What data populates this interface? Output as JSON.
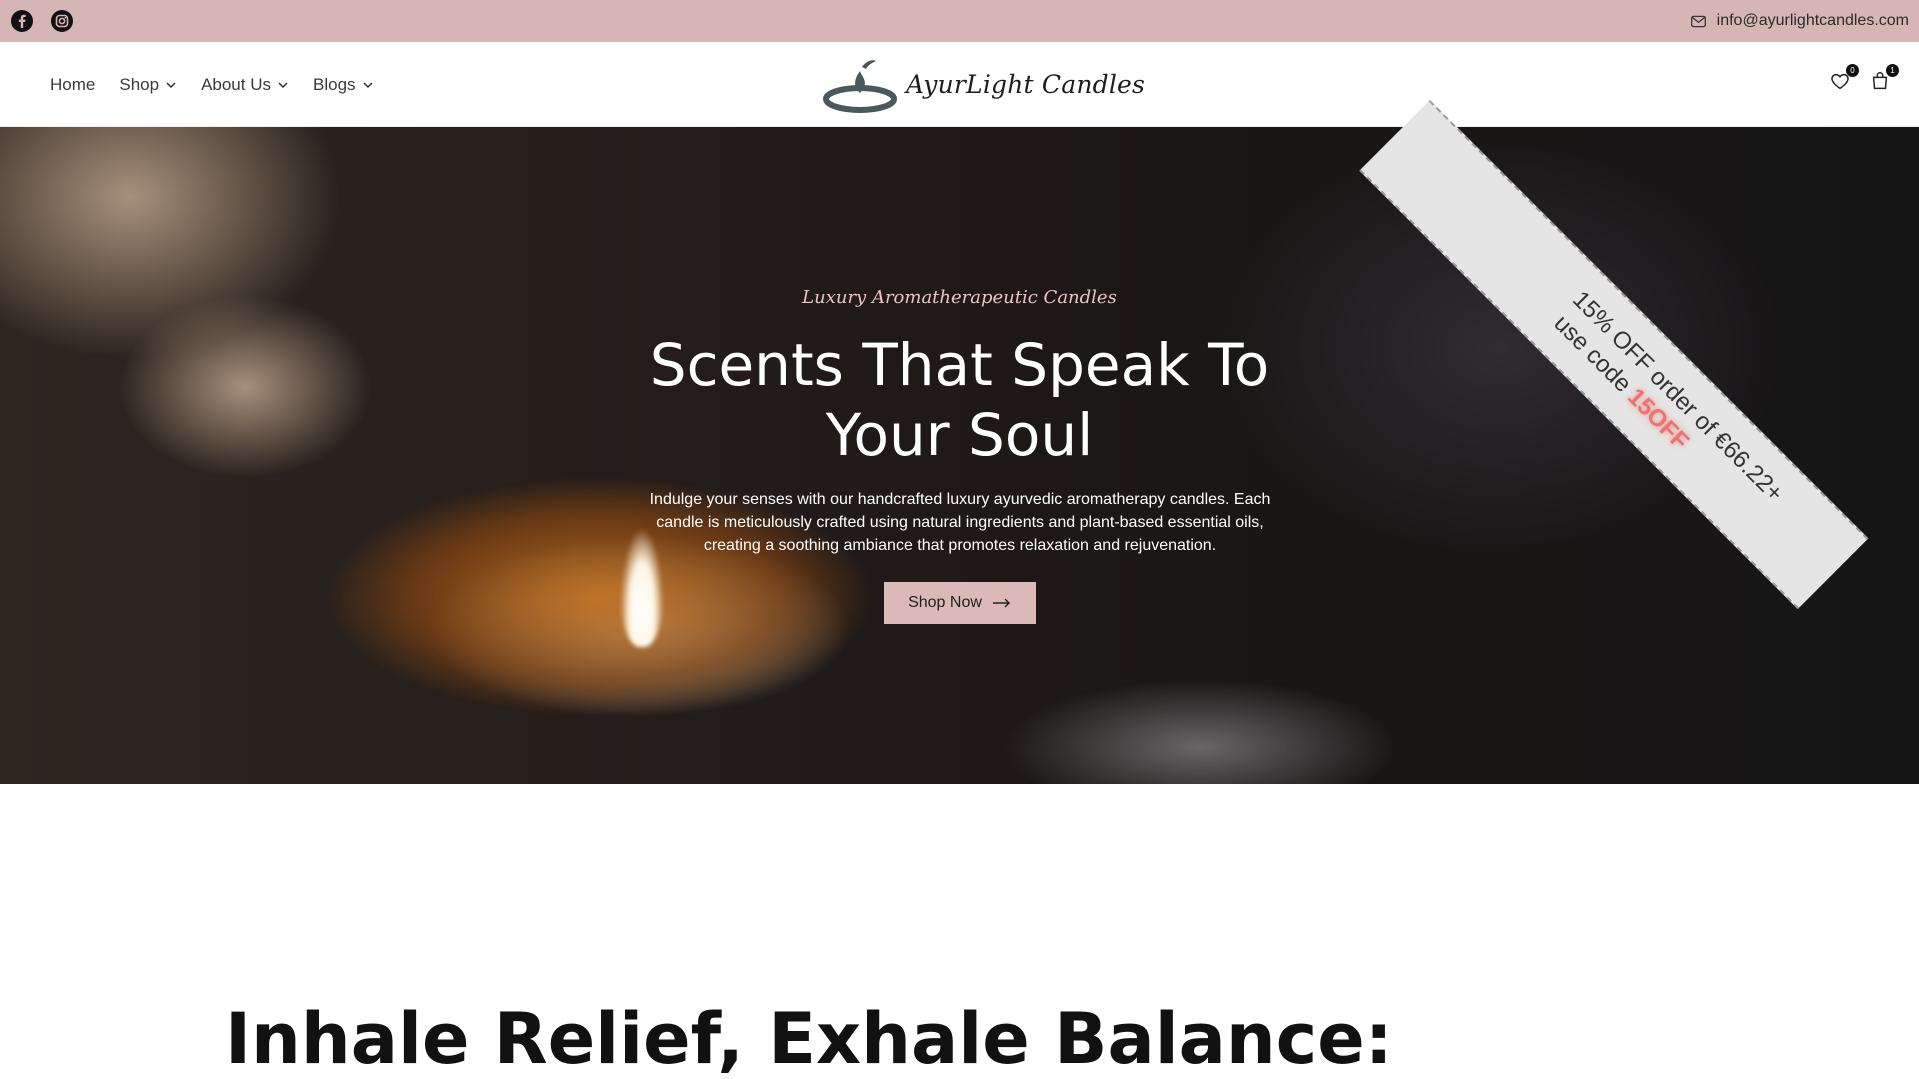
{
  "topbar": {
    "email": "info@ayurlightcandles.com",
    "social": [
      "facebook-icon",
      "instagram-icon"
    ]
  },
  "nav": {
    "items": [
      {
        "label": "Home",
        "dropdown": false
      },
      {
        "label": "Shop",
        "dropdown": true
      },
      {
        "label": "About Us",
        "dropdown": true
      },
      {
        "label": "Blogs",
        "dropdown": true
      }
    ]
  },
  "brand": {
    "name": "AyurLight Candles",
    "logo_color": "#4a5a5c"
  },
  "header_icons": {
    "wishlist_count": "0",
    "cart_count": "1"
  },
  "hero": {
    "kicker": "Luxury Aromatherapeutic Candles",
    "title_line1": "Scents That Speak To",
    "title_line2": "Your Soul",
    "description": "Indulge your senses with our handcrafted luxury ayurvedic aromatherapy candles. Each candle is meticulously crafted using natural ingredients and plant-based essential oils, creating a soothing ambiance that promotes relaxation and rejuvenation.",
    "cta_label": "Shop Now"
  },
  "ribbon": {
    "line1": "15% OFF order of €66.22+",
    "line2_prefix": "use code ",
    "code": "15OFF"
  },
  "section": {
    "title": "Inhale Relief, Exhale Balance:"
  },
  "colors": {
    "topbar": "#d6b5b5",
    "button": "#dcb9b9",
    "kicker": "#e9c4c4",
    "code": "#f07070"
  }
}
